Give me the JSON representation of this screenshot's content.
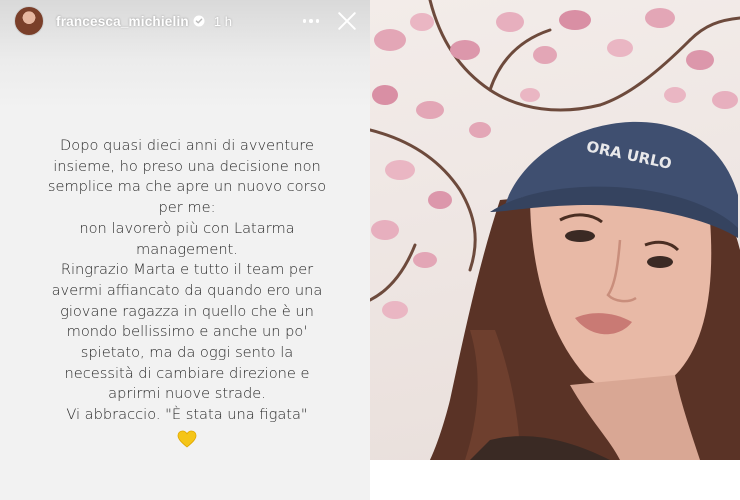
{
  "story": {
    "username": "francesca_michielin",
    "timestamp": "1 h",
    "text_lines": [
      "Dopo quasi dieci anni di avventure",
      "insieme, ho preso una decisione non",
      "semplice ma che apre un nuovo corso",
      "per me:",
      "non lavorerò più con Latarma",
      "management.",
      "Ringrazio Marta e tutto il team per",
      "avermi affiancato da quando ero una",
      "giovane ragazza in quello che è un",
      "mondo bellissimo e anche un po'",
      "spietato, ma da oggi sento la",
      "necessità di cambiare direzione e",
      "aprirmi nuove strade.",
      "Vi abbraccio. \"È stata una figata\""
    ],
    "emoji": "yellow-heart-icon"
  },
  "photo": {
    "cap_text": "ORA URLO"
  },
  "colors": {
    "story_background": "#f2f2f2",
    "text": "#2b2b2b",
    "cap": "#3f4f70",
    "hair": "#5a3326",
    "blossom": "#e3a6b6",
    "heart": "#f5c518"
  }
}
